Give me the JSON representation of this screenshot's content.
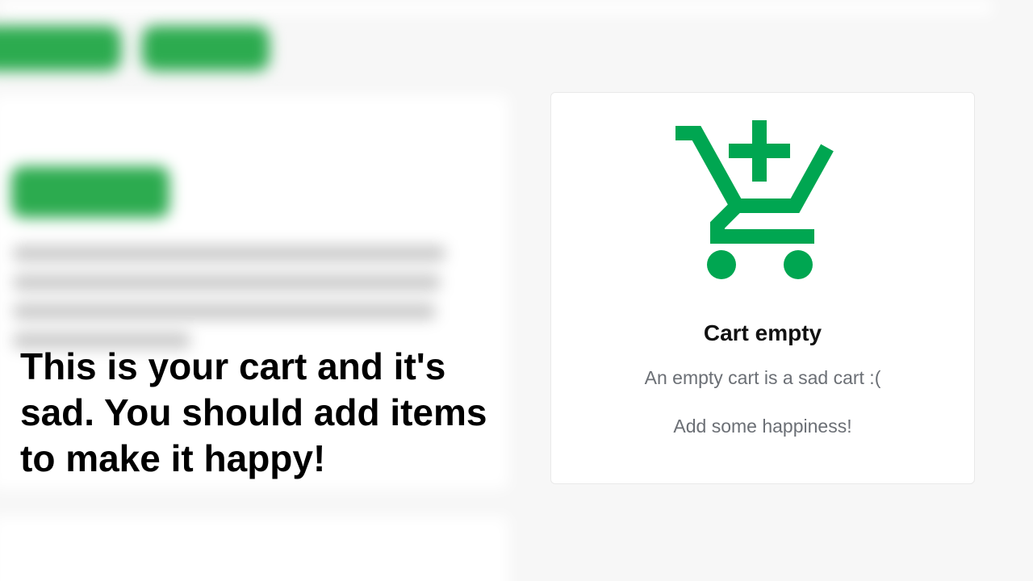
{
  "background": {
    "buttons": [
      "",
      ""
    ],
    "products": [
      {
        "name": "",
        "model": "",
        "button_label": "",
        "price": ""
      },
      {
        "name": "",
        "model": ""
      }
    ]
  },
  "caption": {
    "text": "This is your cart and it's sad. You should add items to make it happy!"
  },
  "cart": {
    "icon": "cart-plus-icon",
    "title": "Cart empty",
    "subtitle": "An empty cart is a sad cart :(",
    "cta": "Add some happiness!"
  },
  "colors": {
    "accent": "#00a651",
    "muted_text": "#6b6f75",
    "page_bg": "#f7f7f7"
  }
}
